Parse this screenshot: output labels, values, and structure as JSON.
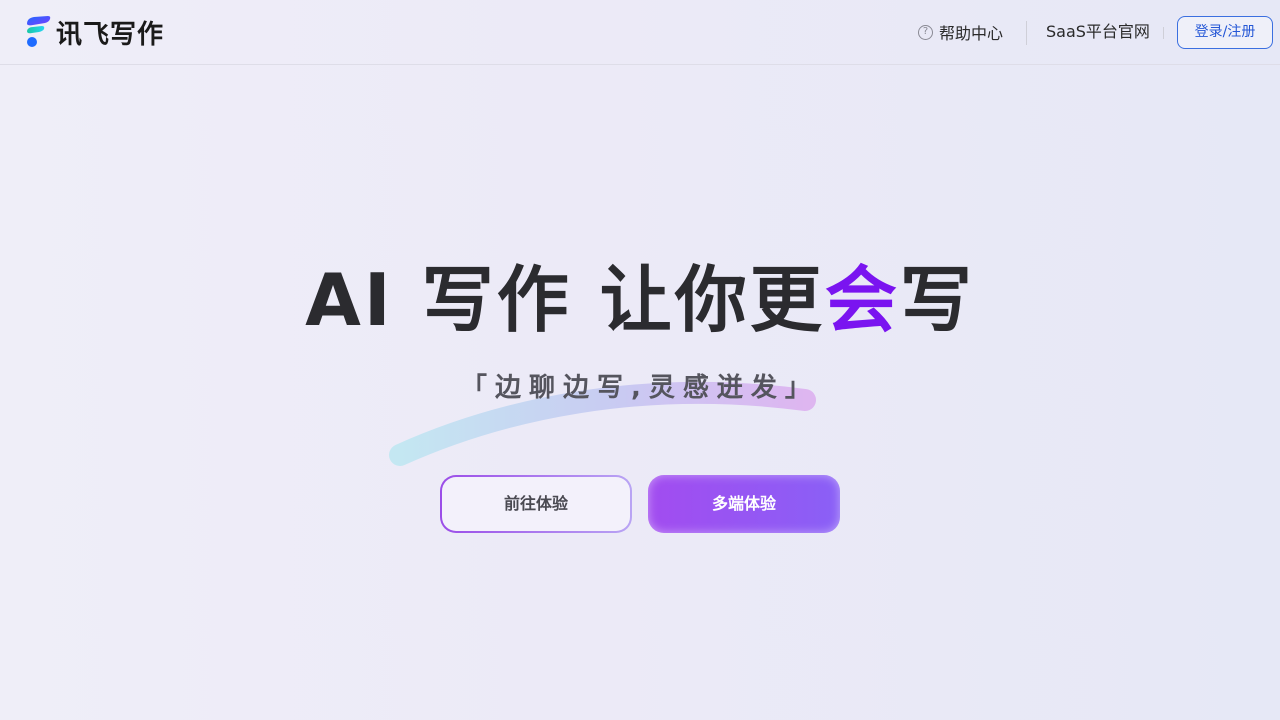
{
  "header": {
    "logo_text": "讯飞写作",
    "help_icon_glyph": "?",
    "help_label": "帮助中心",
    "saas_label": "SaaS平台官网",
    "login_label": "登录/注册"
  },
  "hero": {
    "title_main": "AI 写作 让你更",
    "title_accent": "会",
    "title_end": "写",
    "subtitle": "「边聊边写,灵感迸发」",
    "accent_color": "#7a14f0"
  },
  "actions": {
    "try_label": "前往体验",
    "multi_label": "多端体验"
  },
  "icons": {
    "logo": "xunfei-logo-icon",
    "help": "question-circle-icon"
  }
}
